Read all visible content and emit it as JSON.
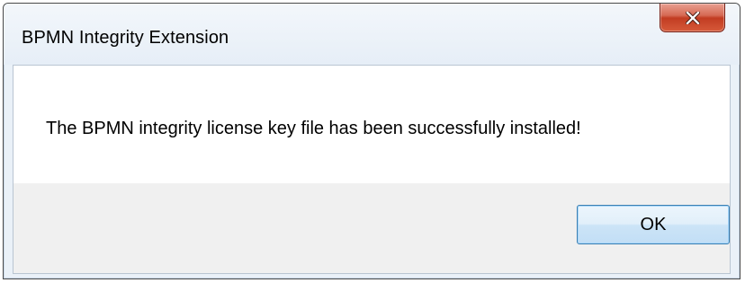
{
  "window": {
    "title": "BPMN Integrity Extension",
    "close_icon": "close-icon"
  },
  "dialog": {
    "message": "The BPMN integrity license key file has been successfully installed!",
    "ok_label": "OK"
  },
  "colors": {
    "close_button": "#c7432a",
    "button_border": "#3c7fb1",
    "dialog_background": "#f0f0f0",
    "message_background": "#ffffff"
  }
}
